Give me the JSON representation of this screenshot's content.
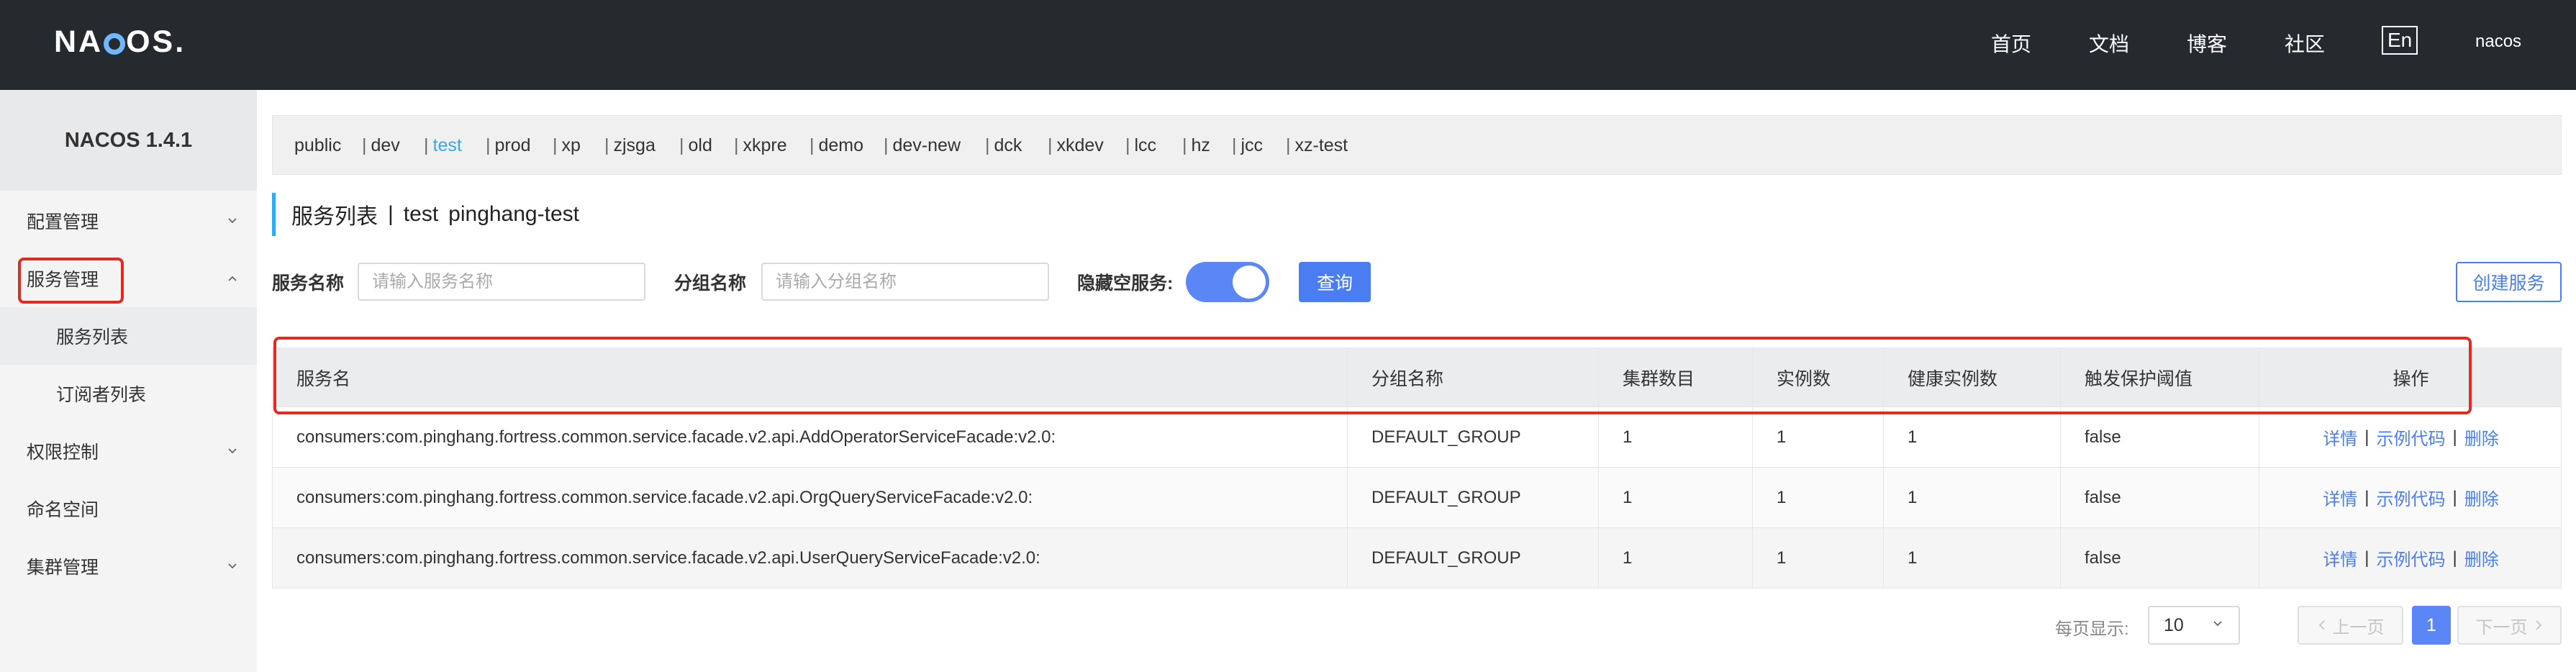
{
  "header": {
    "logo": "NACOS.",
    "nav": [
      "首页",
      "文档",
      "博客",
      "社区"
    ],
    "lang": "En",
    "user": "nacos"
  },
  "sidebar": {
    "version": "NACOS 1.4.1",
    "items": [
      {
        "label": "配置管理"
      },
      {
        "label": "服务管理"
      },
      {
        "label": "服务列表"
      },
      {
        "label": "订阅者列表"
      },
      {
        "label": "权限控制"
      },
      {
        "label": "命名空间"
      },
      {
        "label": "集群管理"
      }
    ]
  },
  "namespaces": [
    "public",
    "dev",
    "test",
    "prod",
    "xp",
    "zjsga",
    "old",
    "xkpre",
    "demo",
    "dev-new",
    "dck",
    "xkdev",
    "lcc",
    "hz",
    "jcc",
    "xz-test"
  ],
  "active_namespace": "test",
  "page": {
    "title": "服务列表",
    "separator": "|",
    "namespace": "test",
    "namespace_desc": "pinghang-test"
  },
  "filters": {
    "service_name_label": "服务名称",
    "service_name_placeholder": "请输入服务名称",
    "group_name_label": "分组名称",
    "group_name_placeholder": "请输入分组名称",
    "hide_empty_label": "隐藏空服务:",
    "hide_empty_on": true,
    "query_button": "查询",
    "create_button": "创建服务"
  },
  "table": {
    "columns": [
      "服务名",
      "分组名称",
      "集群数目",
      "实例数",
      "健康实例数",
      "触发保护阈值",
      "操作"
    ],
    "rows": [
      {
        "name": "consumers:com.pinghang.fortress.common.service.facade.v2.api.AddOperatorServiceFacade:v2.0:",
        "group": "DEFAULT_GROUP",
        "clusters": "1",
        "instances": "1",
        "healthy": "1",
        "threshold": "false"
      },
      {
        "name": "consumers:com.pinghang.fortress.common.service.facade.v2.api.OrgQueryServiceFacade:v2.0:",
        "group": "DEFAULT_GROUP",
        "clusters": "1",
        "instances": "1",
        "healthy": "1",
        "threshold": "false"
      },
      {
        "name": "consumers:com.pinghang.fortress.common.service.facade.v2.api.UserQueryServiceFacade:v2.0:",
        "group": "DEFAULT_GROUP",
        "clusters": "1",
        "instances": "1",
        "healthy": "1",
        "threshold": "false"
      }
    ],
    "ops": {
      "detail": "详情",
      "sep": "|",
      "sample": "示例代码",
      "delete": "删除"
    }
  },
  "pagination": {
    "page_size_label": "每页显示:",
    "page_size": "10",
    "prev": "上一页",
    "current": "1",
    "next": "下一页"
  },
  "colors": {
    "topbar": "#252a2f",
    "accent": "#4a7df2",
    "active_namespace": "#33aaee",
    "highlight": "#e02b20"
  },
  "icons": [
    "chevron-down-icon",
    "chevron-up-icon",
    "chevron-left-icon",
    "chevron-right-icon"
  ]
}
